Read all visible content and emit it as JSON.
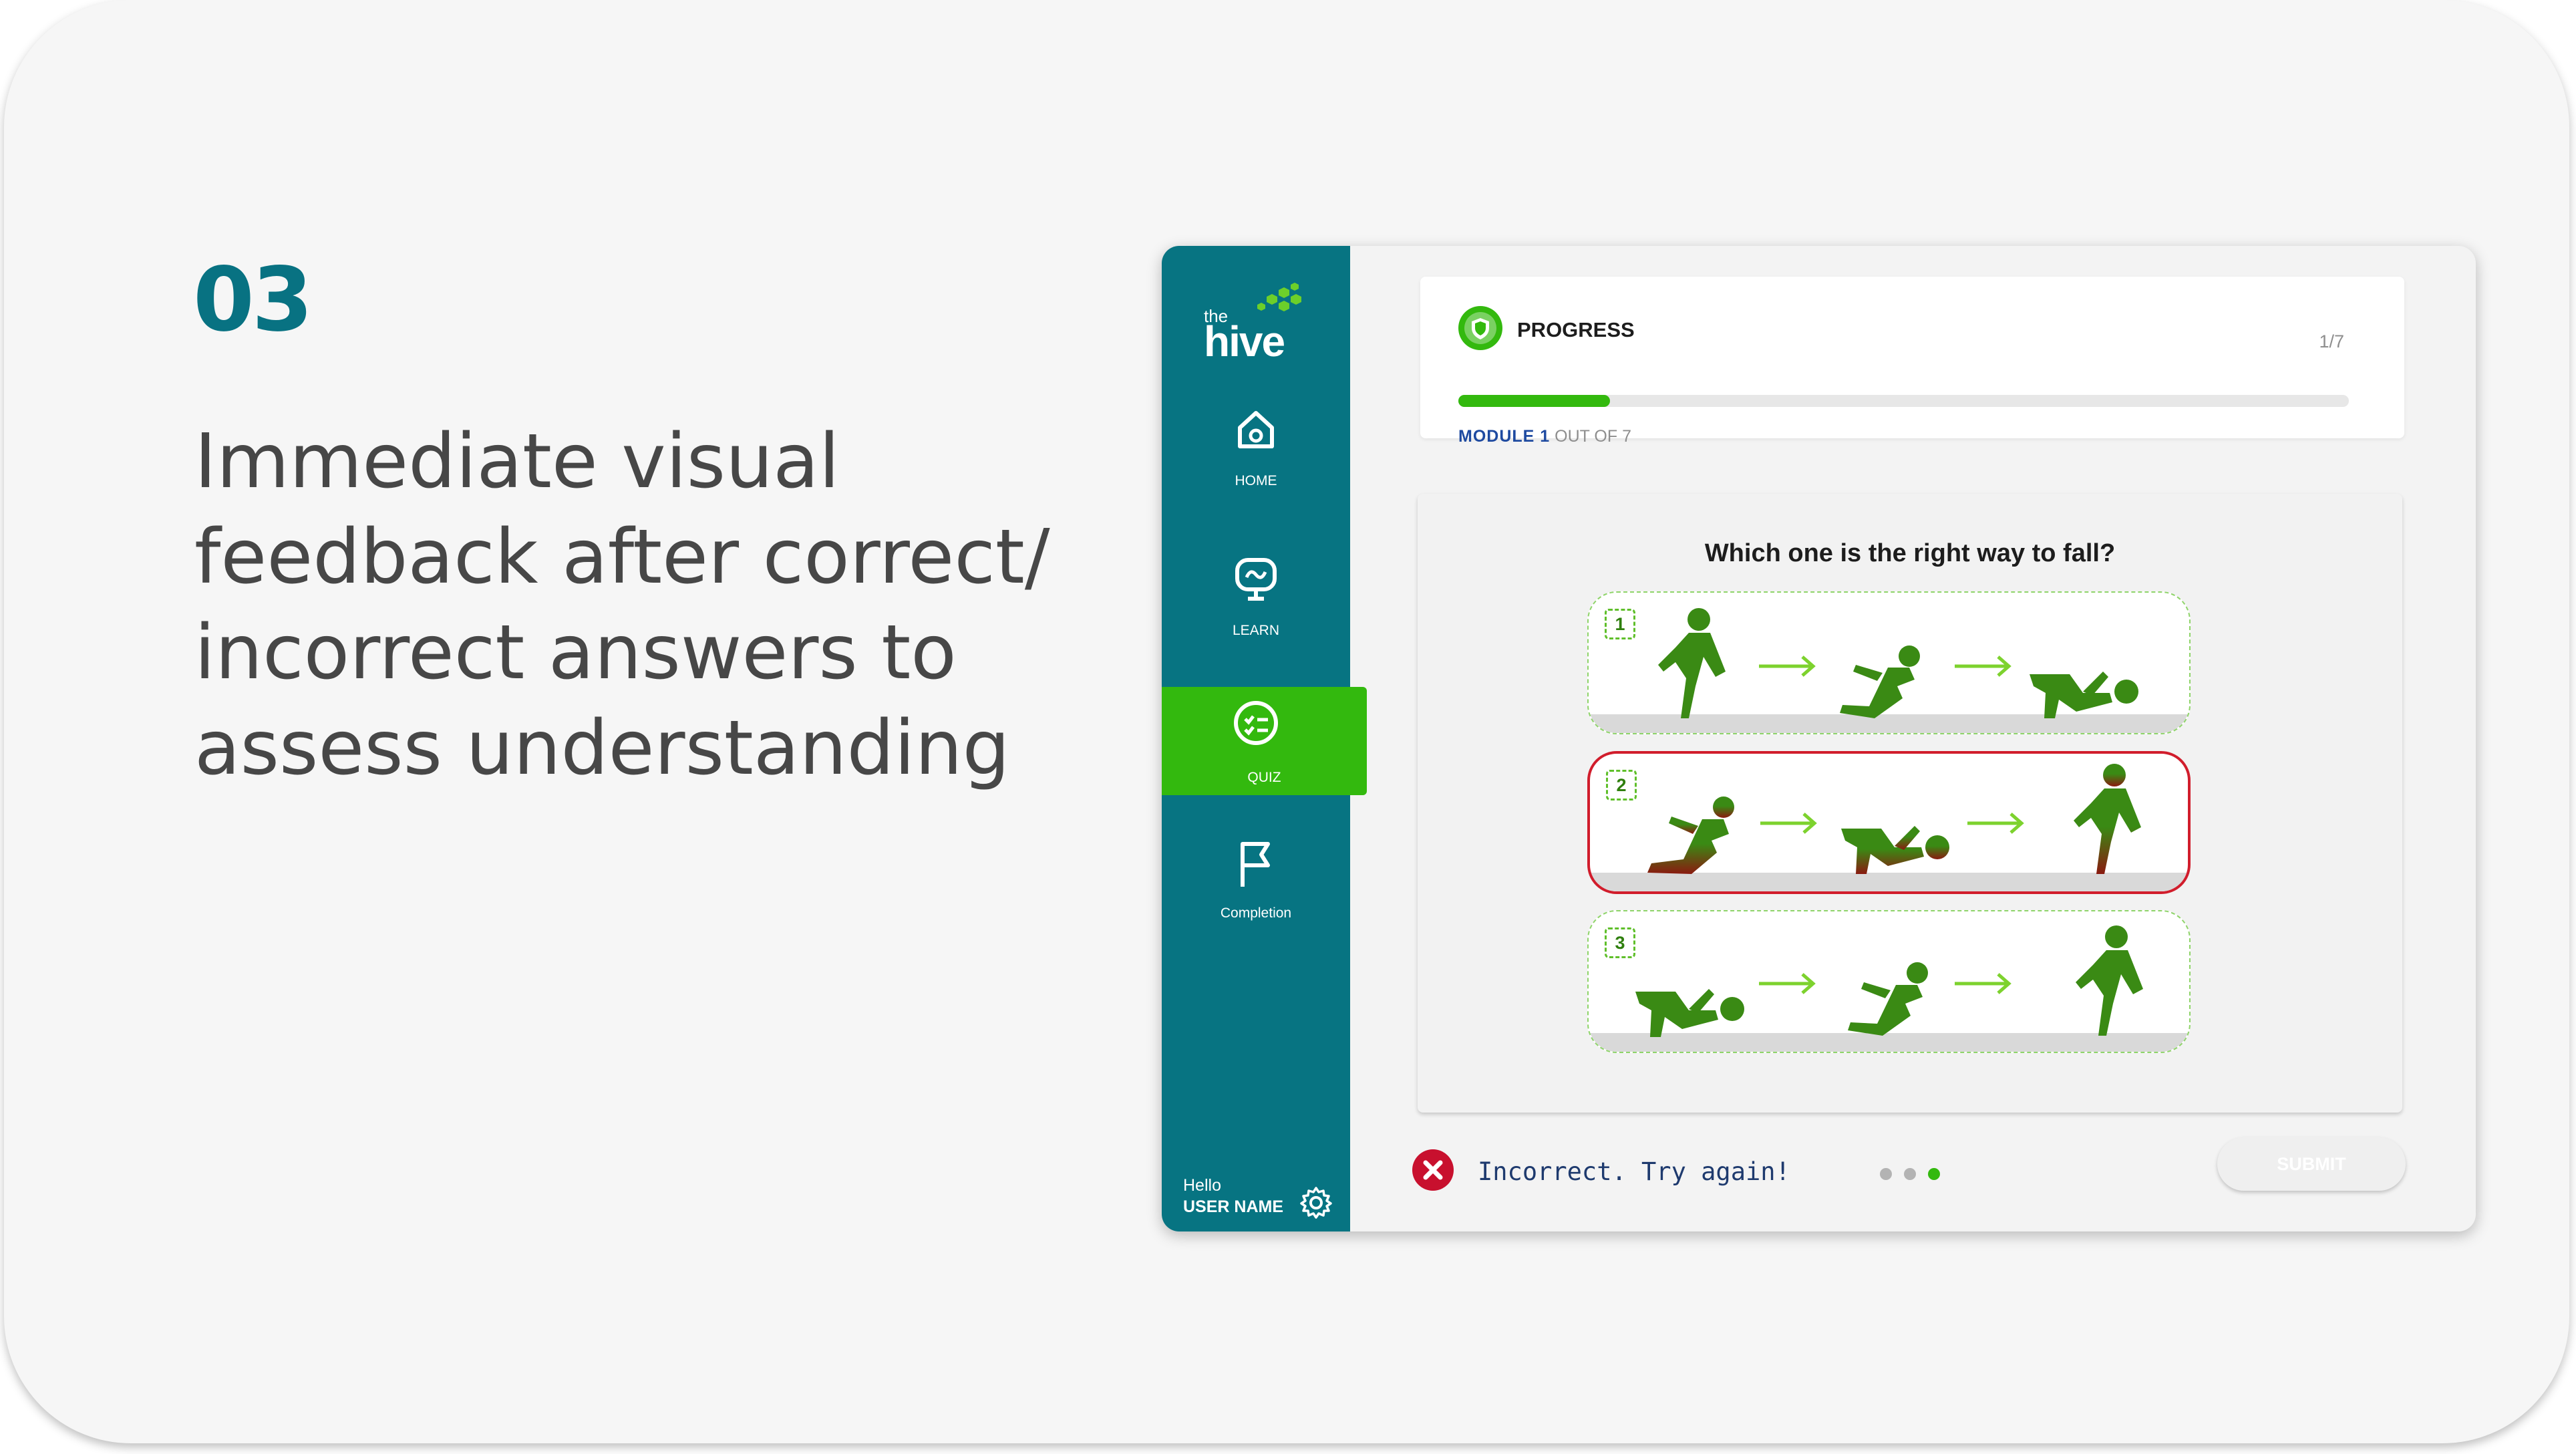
{
  "slide": {
    "step_number": "03",
    "headline": "Immediate visual feedback after correct/ incorrect answers to assess understanding"
  },
  "app": {
    "brand": {
      "small": "the",
      "name": "hive"
    },
    "sidebar": {
      "items": [
        {
          "label": "HOME",
          "icon": "home-icon",
          "active": false
        },
        {
          "label": "LEARN",
          "icon": "monitor-icon",
          "active": false
        },
        {
          "label": "QUIZ",
          "icon": "quiz-icon",
          "active": true
        },
        {
          "label": "Completion",
          "icon": "flag-icon",
          "active": false
        }
      ],
      "user": {
        "greeting": "Hello",
        "name": "USER NAME"
      }
    },
    "progress": {
      "title": "PROGRESS",
      "count": "1/7",
      "fraction": 0.17,
      "module_label": "MODULE 1",
      "out_of": "OUT OF 7"
    },
    "quiz": {
      "question": "Which one is the right way to fall?",
      "options": [
        {
          "number": "1",
          "state": "unselected"
        },
        {
          "number": "2",
          "state": "selected-incorrect"
        },
        {
          "number": "3",
          "state": "unselected"
        }
      ]
    },
    "feedback": {
      "icon": "close-icon",
      "text": "Incorrect. Try again!"
    },
    "pager": {
      "count": 3,
      "active_index": 2
    },
    "submit_label": "SUBMIT"
  },
  "colors": {
    "teal": "#077482",
    "green": "#33b90e",
    "figure_green": "#3a8a14",
    "error_red": "#c8102e",
    "text_dark": "#474747"
  }
}
